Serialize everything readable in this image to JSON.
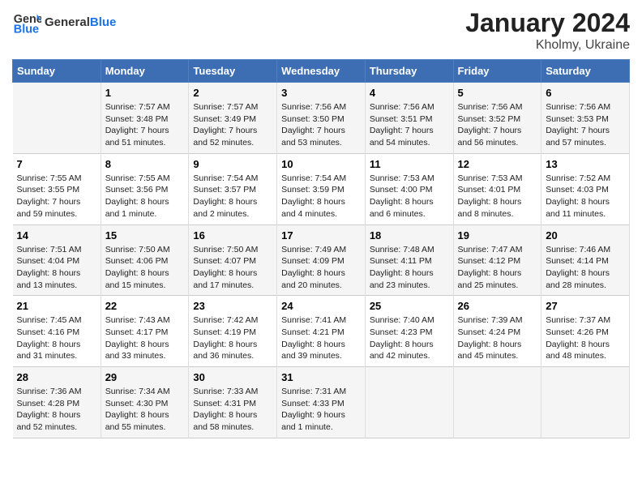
{
  "header": {
    "logo_text_general": "General",
    "logo_text_blue": "Blue",
    "month": "January 2024",
    "location": "Kholmy, Ukraine"
  },
  "days_of_week": [
    "Sunday",
    "Monday",
    "Tuesday",
    "Wednesday",
    "Thursday",
    "Friday",
    "Saturday"
  ],
  "weeks": [
    [
      {
        "day": "",
        "sunrise": "",
        "sunset": "",
        "daylight": ""
      },
      {
        "day": "1",
        "sunrise": "Sunrise: 7:57 AM",
        "sunset": "Sunset: 3:48 PM",
        "daylight": "Daylight: 7 hours and 51 minutes."
      },
      {
        "day": "2",
        "sunrise": "Sunrise: 7:57 AM",
        "sunset": "Sunset: 3:49 PM",
        "daylight": "Daylight: 7 hours and 52 minutes."
      },
      {
        "day": "3",
        "sunrise": "Sunrise: 7:56 AM",
        "sunset": "Sunset: 3:50 PM",
        "daylight": "Daylight: 7 hours and 53 minutes."
      },
      {
        "day": "4",
        "sunrise": "Sunrise: 7:56 AM",
        "sunset": "Sunset: 3:51 PM",
        "daylight": "Daylight: 7 hours and 54 minutes."
      },
      {
        "day": "5",
        "sunrise": "Sunrise: 7:56 AM",
        "sunset": "Sunset: 3:52 PM",
        "daylight": "Daylight: 7 hours and 56 minutes."
      },
      {
        "day": "6",
        "sunrise": "Sunrise: 7:56 AM",
        "sunset": "Sunset: 3:53 PM",
        "daylight": "Daylight: 7 hours and 57 minutes."
      }
    ],
    [
      {
        "day": "7",
        "sunrise": "Sunrise: 7:55 AM",
        "sunset": "Sunset: 3:55 PM",
        "daylight": "Daylight: 7 hours and 59 minutes."
      },
      {
        "day": "8",
        "sunrise": "Sunrise: 7:55 AM",
        "sunset": "Sunset: 3:56 PM",
        "daylight": "Daylight: 8 hours and 1 minute."
      },
      {
        "day": "9",
        "sunrise": "Sunrise: 7:54 AM",
        "sunset": "Sunset: 3:57 PM",
        "daylight": "Daylight: 8 hours and 2 minutes."
      },
      {
        "day": "10",
        "sunrise": "Sunrise: 7:54 AM",
        "sunset": "Sunset: 3:59 PM",
        "daylight": "Daylight: 8 hours and 4 minutes."
      },
      {
        "day": "11",
        "sunrise": "Sunrise: 7:53 AM",
        "sunset": "Sunset: 4:00 PM",
        "daylight": "Daylight: 8 hours and 6 minutes."
      },
      {
        "day": "12",
        "sunrise": "Sunrise: 7:53 AM",
        "sunset": "Sunset: 4:01 PM",
        "daylight": "Daylight: 8 hours and 8 minutes."
      },
      {
        "day": "13",
        "sunrise": "Sunrise: 7:52 AM",
        "sunset": "Sunset: 4:03 PM",
        "daylight": "Daylight: 8 hours and 11 minutes."
      }
    ],
    [
      {
        "day": "14",
        "sunrise": "Sunrise: 7:51 AM",
        "sunset": "Sunset: 4:04 PM",
        "daylight": "Daylight: 8 hours and 13 minutes."
      },
      {
        "day": "15",
        "sunrise": "Sunrise: 7:50 AM",
        "sunset": "Sunset: 4:06 PM",
        "daylight": "Daylight: 8 hours and 15 minutes."
      },
      {
        "day": "16",
        "sunrise": "Sunrise: 7:50 AM",
        "sunset": "Sunset: 4:07 PM",
        "daylight": "Daylight: 8 hours and 17 minutes."
      },
      {
        "day": "17",
        "sunrise": "Sunrise: 7:49 AM",
        "sunset": "Sunset: 4:09 PM",
        "daylight": "Daylight: 8 hours and 20 minutes."
      },
      {
        "day": "18",
        "sunrise": "Sunrise: 7:48 AM",
        "sunset": "Sunset: 4:11 PM",
        "daylight": "Daylight: 8 hours and 23 minutes."
      },
      {
        "day": "19",
        "sunrise": "Sunrise: 7:47 AM",
        "sunset": "Sunset: 4:12 PM",
        "daylight": "Daylight: 8 hours and 25 minutes."
      },
      {
        "day": "20",
        "sunrise": "Sunrise: 7:46 AM",
        "sunset": "Sunset: 4:14 PM",
        "daylight": "Daylight: 8 hours and 28 minutes."
      }
    ],
    [
      {
        "day": "21",
        "sunrise": "Sunrise: 7:45 AM",
        "sunset": "Sunset: 4:16 PM",
        "daylight": "Daylight: 8 hours and 31 minutes."
      },
      {
        "day": "22",
        "sunrise": "Sunrise: 7:43 AM",
        "sunset": "Sunset: 4:17 PM",
        "daylight": "Daylight: 8 hours and 33 minutes."
      },
      {
        "day": "23",
        "sunrise": "Sunrise: 7:42 AM",
        "sunset": "Sunset: 4:19 PM",
        "daylight": "Daylight: 8 hours and 36 minutes."
      },
      {
        "day": "24",
        "sunrise": "Sunrise: 7:41 AM",
        "sunset": "Sunset: 4:21 PM",
        "daylight": "Daylight: 8 hours and 39 minutes."
      },
      {
        "day": "25",
        "sunrise": "Sunrise: 7:40 AM",
        "sunset": "Sunset: 4:23 PM",
        "daylight": "Daylight: 8 hours and 42 minutes."
      },
      {
        "day": "26",
        "sunrise": "Sunrise: 7:39 AM",
        "sunset": "Sunset: 4:24 PM",
        "daylight": "Daylight: 8 hours and 45 minutes."
      },
      {
        "day": "27",
        "sunrise": "Sunrise: 7:37 AM",
        "sunset": "Sunset: 4:26 PM",
        "daylight": "Daylight: 8 hours and 48 minutes."
      }
    ],
    [
      {
        "day": "28",
        "sunrise": "Sunrise: 7:36 AM",
        "sunset": "Sunset: 4:28 PM",
        "daylight": "Daylight: 8 hours and 52 minutes."
      },
      {
        "day": "29",
        "sunrise": "Sunrise: 7:34 AM",
        "sunset": "Sunset: 4:30 PM",
        "daylight": "Daylight: 8 hours and 55 minutes."
      },
      {
        "day": "30",
        "sunrise": "Sunrise: 7:33 AM",
        "sunset": "Sunset: 4:31 PM",
        "daylight": "Daylight: 8 hours and 58 minutes."
      },
      {
        "day": "31",
        "sunrise": "Sunrise: 7:31 AM",
        "sunset": "Sunset: 4:33 PM",
        "daylight": "Daylight: 9 hours and 1 minute."
      },
      {
        "day": "",
        "sunrise": "",
        "sunset": "",
        "daylight": ""
      },
      {
        "day": "",
        "sunrise": "",
        "sunset": "",
        "daylight": ""
      },
      {
        "day": "",
        "sunrise": "",
        "sunset": "",
        "daylight": ""
      }
    ]
  ]
}
